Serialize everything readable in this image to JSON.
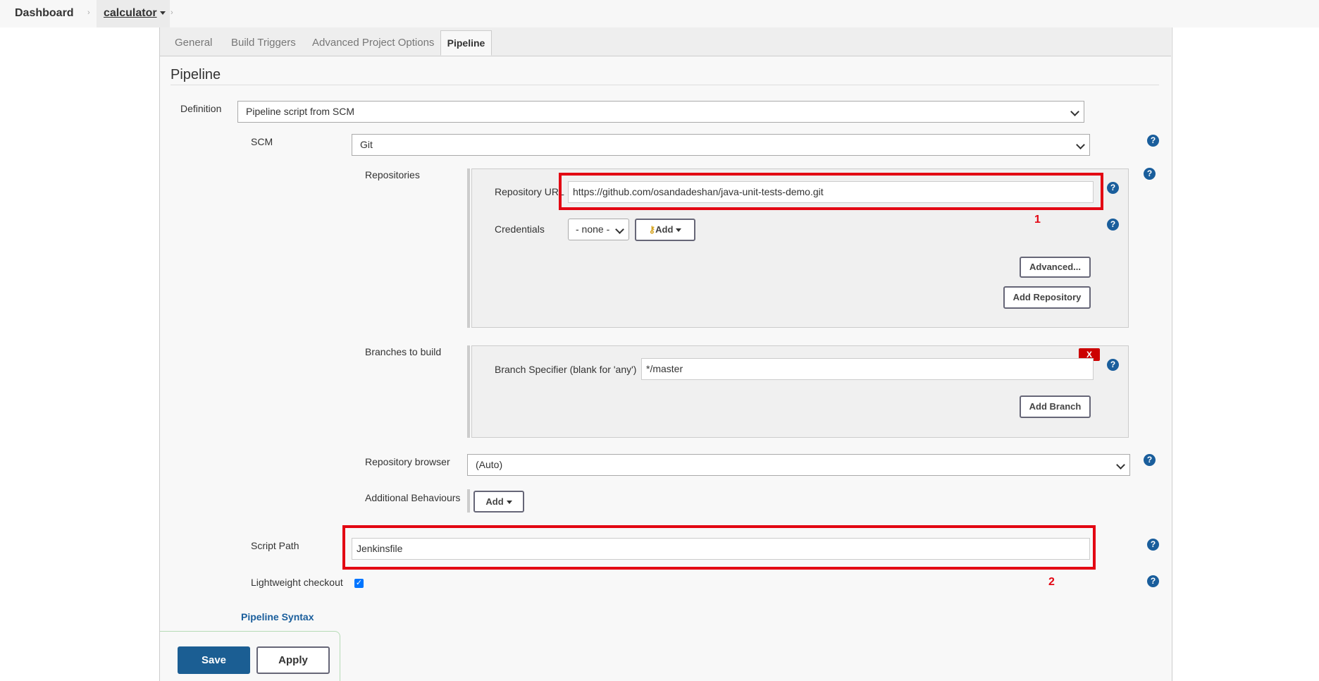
{
  "breadcrumb": {
    "dashboard": "Dashboard",
    "job": "calculator"
  },
  "tabs": [
    "General",
    "Build Triggers",
    "Advanced Project Options",
    "Pipeline"
  ],
  "section_title": "Pipeline",
  "definition": {
    "label": "Definition",
    "value": "Pipeline script from SCM"
  },
  "scm": {
    "label": "SCM",
    "value": "Git"
  },
  "repositories": {
    "label": "Repositories",
    "url_label": "Repository URL",
    "url_value": "https://github.com/osandadeshan/java-unit-tests-demo.git",
    "credentials_label": "Credentials",
    "credentials_value": "- none -",
    "add_label": "Add",
    "advanced_label": "Advanced...",
    "add_repository_label": "Add Repository"
  },
  "branches": {
    "label": "Branches to build",
    "delete_label": "X",
    "specifier_label": "Branch Specifier (blank for 'any')",
    "specifier_value": "*/master",
    "add_branch_label": "Add Branch"
  },
  "repo_browser": {
    "label": "Repository browser",
    "value": "(Auto)"
  },
  "additional_behaviours": {
    "label": "Additional Behaviours",
    "add_label": "Add"
  },
  "script_path": {
    "label": "Script Path",
    "value": "Jenkinsfile"
  },
  "lightweight_checkout": {
    "label": "Lightweight checkout",
    "checked": true
  },
  "pipeline_syntax": "Pipeline Syntax",
  "markers": {
    "first": "1",
    "second": "2"
  },
  "help_glyph": "?",
  "buttons": {
    "save": "Save",
    "apply": "Apply"
  },
  "colors": {
    "accent": "#1a5e9c",
    "highlight": "#e30613",
    "save": "#1b5e93"
  }
}
